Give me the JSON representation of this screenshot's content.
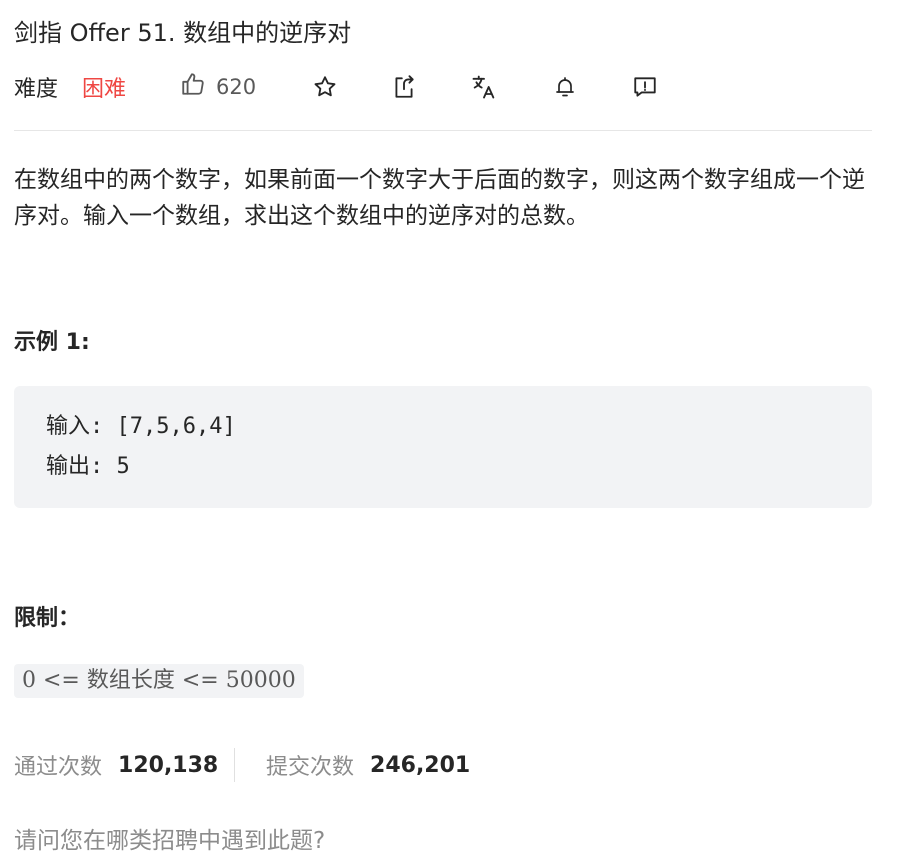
{
  "problem": {
    "title": "剑指 Offer 51. 数组中的逆序对",
    "difficulty_label": "难度",
    "difficulty_value": "困难",
    "likes": "620",
    "description": "在数组中的两个数字，如果前面一个数字大于后面的数字，则这两个数字组成一个逆序对。输入一个数组，求出这个数组中的逆序对的总数。"
  },
  "example": {
    "heading": "示例 1:",
    "input_line": "输入: [7,5,6,4]",
    "output_line": "输出: 5"
  },
  "limits": {
    "heading": "限制：",
    "code": "0 <= 数组长度 <= 50000"
  },
  "stats": {
    "accepted_label": "通过次数",
    "accepted_value": "120,138",
    "submissions_label": "提交次数",
    "submissions_value": "246,201"
  },
  "footer": {
    "question": "请问您在哪类招聘中遇到此题?"
  },
  "icons": [
    "thumbs-up-icon",
    "star-icon",
    "share-icon",
    "translate-icon",
    "bell-icon",
    "feedback-icon"
  ],
  "colors": {
    "difficulty_hard": "#ef4743",
    "muted_text": "#8c8c8c",
    "code_bg": "#f2f3f5"
  }
}
